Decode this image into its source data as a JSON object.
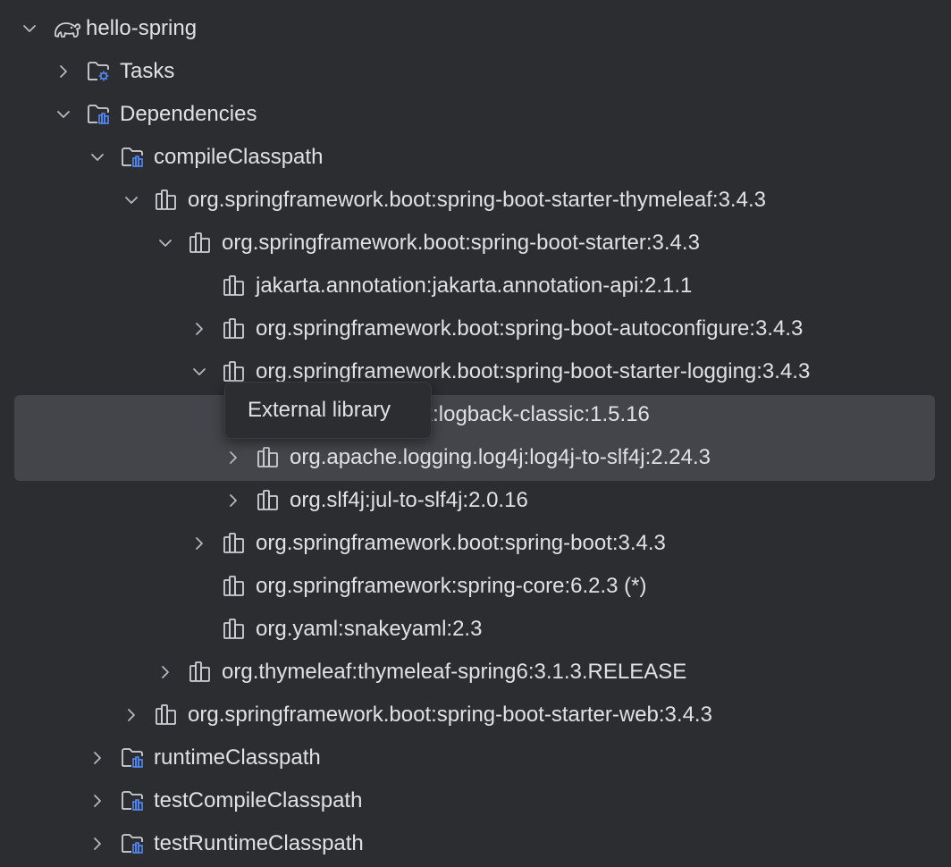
{
  "tree": {
    "items": [
      {
        "label": "hello-spring",
        "level": 0,
        "chevron": "down",
        "icon": "gradle-elephant-icon"
      },
      {
        "label": "Tasks",
        "level": 1,
        "chevron": "right",
        "icon": "folder-tasks-icon"
      },
      {
        "label": "Dependencies",
        "level": 1,
        "chevron": "down",
        "icon": "folder-dependencies-icon"
      },
      {
        "label": "compileClasspath",
        "level": 2,
        "chevron": "down",
        "icon": "folder-dependencies-icon"
      },
      {
        "label": "org.springframework.boot:spring-boot-starter-thymeleaf:3.4.3",
        "level": 3,
        "chevron": "down",
        "icon": "library-icon"
      },
      {
        "label": "org.springframework.boot:spring-boot-starter:3.4.3",
        "level": 4,
        "chevron": "down",
        "icon": "library-icon"
      },
      {
        "label": "jakarta.annotation:jakarta.annotation-api:2.1.1",
        "level": 5,
        "chevron": "none",
        "icon": "library-icon"
      },
      {
        "label": "org.springframework.boot:spring-boot-autoconfigure:3.4.3",
        "level": 5,
        "chevron": "right",
        "icon": "library-icon"
      },
      {
        "label": "org.springframework.boot:spring-boot-starter-logging:3.4.3",
        "level": 5,
        "chevron": "down",
        "icon": "library-icon"
      },
      {
        "label": "ch.qos.logback:logback-classic:1.5.16",
        "level": 6,
        "chevron": "right",
        "icon": "library-icon",
        "selected": true
      },
      {
        "label": "org.apache.logging.log4j:log4j-to-slf4j:2.24.3",
        "level": 6,
        "chevron": "right",
        "icon": "library-icon",
        "selected": true
      },
      {
        "label": "org.slf4j:jul-to-slf4j:2.0.16",
        "level": 6,
        "chevron": "right",
        "icon": "library-icon"
      },
      {
        "label": "org.springframework.boot:spring-boot:3.4.3",
        "level": 5,
        "chevron": "right",
        "icon": "library-icon"
      },
      {
        "label": "org.springframework:spring-core:6.2.3 (*)",
        "level": 5,
        "chevron": "none",
        "icon": "library-icon"
      },
      {
        "label": "org.yaml:snakeyaml:2.3",
        "level": 5,
        "chevron": "none",
        "icon": "library-icon"
      },
      {
        "label": "org.thymeleaf:thymeleaf-spring6:3.1.3.RELEASE",
        "level": 4,
        "chevron": "right",
        "icon": "library-icon"
      },
      {
        "label": "org.springframework.boot:spring-boot-starter-web:3.4.3",
        "level": 3,
        "chevron": "right",
        "icon": "library-icon"
      },
      {
        "label": "runtimeClasspath",
        "level": 2,
        "chevron": "right",
        "icon": "folder-dependencies-icon"
      },
      {
        "label": "testCompileClasspath",
        "level": 2,
        "chevron": "right",
        "icon": "folder-dependencies-icon"
      },
      {
        "label": "testRuntimeClasspath",
        "level": 2,
        "chevron": "right",
        "icon": "folder-dependencies-icon"
      }
    ]
  },
  "tooltip": {
    "text": "External library"
  },
  "colors": {
    "background": "#2b2d30",
    "selection": "#43454a",
    "text": "#dfe1e5",
    "chevron": "#b4b8bf",
    "icon": "#ced0d6",
    "accent": "#548af7"
  }
}
